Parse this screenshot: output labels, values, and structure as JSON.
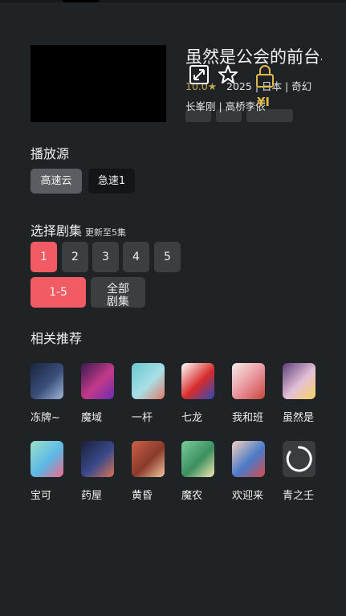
{
  "video": {
    "title": "虽然是公会的前台小姐",
    "rating": "10.0★",
    "meta": "2025 | 日本 | 奇幻",
    "people": "长峯刚 | 高桥李依",
    "vip_label": "¥I",
    "overlay_icons": [
      "fullscreen-icon",
      "star-icon",
      "lock-icon"
    ]
  },
  "sources": {
    "title": "播放源",
    "items": [
      {
        "label": "高速云",
        "active": true
      },
      {
        "label": "急速1",
        "active": false
      }
    ]
  },
  "episodes": {
    "title": "选择剧集",
    "update_note": "更新至5集",
    "items": [
      "1",
      "2",
      "3",
      "4",
      "5"
    ],
    "active_index": 0,
    "ranges": [
      {
        "label": "1-5",
        "active": true
      },
      {
        "label": "全部剧集",
        "active": false
      }
    ]
  },
  "recommend": {
    "title": "相关推荐",
    "items": [
      {
        "label": "冻牌~",
        "colors": [
          "#1a2440",
          "#3a4f7a",
          "#9fb6d9"
        ]
      },
      {
        "label": "魔域",
        "colors": [
          "#3b1a4f",
          "#c23a8a",
          "#6b2bb0"
        ]
      },
      {
        "label": "一杆",
        "colors": [
          "#69c6d3",
          "#a8e0e6",
          "#e07a6a"
        ]
      },
      {
        "label": "七龙",
        "colors": [
          "#ffffff",
          "#d82b2b",
          "#2a4bbd"
        ]
      },
      {
        "label": "我和班",
        "colors": [
          "#f7ece8",
          "#e7929a",
          "#c9433b"
        ]
      },
      {
        "label": "虽然是",
        "colors": [
          "#5b3f7a",
          "#e5c0d7",
          "#f4d35e"
        ]
      },
      {
        "label": "宝可",
        "colors": [
          "#9de0c8",
          "#5cb8e6",
          "#f06a8a"
        ]
      },
      {
        "label": "药屋",
        "colors": [
          "#1a1f3a",
          "#3a4a8a",
          "#d9735a"
        ]
      },
      {
        "label": "黄昏",
        "colors": [
          "#c9614a",
          "#8a3a2a",
          "#f2c6a0"
        ]
      },
      {
        "label": "魔农",
        "colors": [
          "#7acb9a",
          "#3b8f5f",
          "#f2e8b0"
        ]
      },
      {
        "label": "欢迎来",
        "colors": [
          "#f2d0c0",
          "#4a7ac8",
          "#d84a4a"
        ]
      },
      {
        "label": "青之壬",
        "loading": true
      }
    ]
  }
}
